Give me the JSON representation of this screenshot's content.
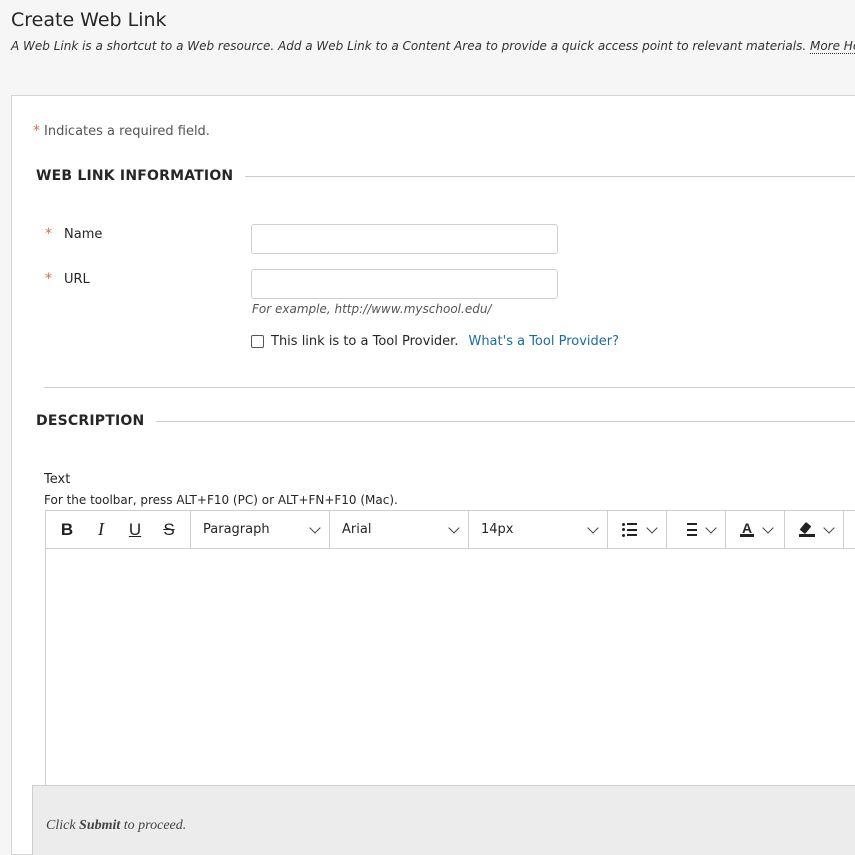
{
  "page": {
    "title": "Create Web Link",
    "description": "A Web Link is a shortcut to a Web resource. Add a Web Link to a Content Area to provide a quick access point to relevant materials.",
    "help_link": "More Help"
  },
  "form": {
    "required_marker": "*",
    "required_note": "Indicates a required field.",
    "section_info": {
      "heading": "WEB LINK INFORMATION",
      "name_label": "Name",
      "name_value": "",
      "url_label": "URL",
      "url_value": "",
      "url_hint": "For example, http://www.myschool.edu/",
      "tool_provider_label": "This link is to a Tool Provider.",
      "tool_provider_checked": false,
      "tool_provider_help": "What's a Tool Provider?"
    },
    "section_description": {
      "heading": "DESCRIPTION",
      "text_label": "Text",
      "toolbar_hint": "For the toolbar, press ALT+F10 (PC) or ALT+FN+F10 (Mac).",
      "editor": {
        "bold": "B",
        "italic": "I",
        "underline": "U",
        "strikethrough": "S",
        "paragraph": "Paragraph",
        "font": "Arial",
        "size": "14px",
        "text_color_glyph": "A",
        "bullet_list_icon": "bullet-list-icon",
        "numbered_list_icon": "numbered-list-icon",
        "highlight_icon": "highlighter-icon",
        "content": ""
      }
    }
  },
  "footer": {
    "prefix": "Click",
    "action": "Submit",
    "suffix": "to proceed."
  },
  "colors": {
    "required": "#e26a43",
    "link": "#1c6ba0",
    "background": "#f6f6f6"
  }
}
